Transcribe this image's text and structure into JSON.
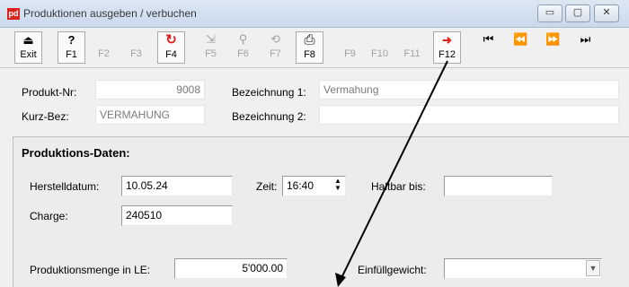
{
  "window": {
    "title": "Produktionen ausgeben / verbuchen",
    "minimize": "▭",
    "maximize": "▢",
    "close": "✕"
  },
  "toolbar": {
    "buttons": [
      {
        "label": "Exit",
        "icon": "cart-icon",
        "glyph": "⏏"
      },
      {
        "label": "F1",
        "icon": "help-icon",
        "glyph": "?"
      },
      {
        "label": "F2",
        "icon": "",
        "glyph": ""
      },
      {
        "label": "F3",
        "icon": "",
        "glyph": ""
      },
      {
        "label": "F4",
        "icon": "refresh-icon",
        "glyph": "↻"
      },
      {
        "label": "F5",
        "icon": "export-icon",
        "glyph": "⇲"
      },
      {
        "label": "F6",
        "icon": "search-icon",
        "glyph": "⚲"
      },
      {
        "label": "F7",
        "icon": "reset-icon",
        "glyph": "⟲"
      },
      {
        "label": "F8",
        "icon": "print-icon",
        "glyph": "⎙"
      },
      {
        "label": "F9",
        "icon": "",
        "glyph": ""
      },
      {
        "label": "F10",
        "icon": "",
        "glyph": ""
      },
      {
        "label": "F11",
        "icon": "",
        "glyph": ""
      },
      {
        "label": "F12",
        "icon": "post-icon",
        "glyph": "➜"
      }
    ],
    "nav": {
      "first": "⏮",
      "prev": "⏪",
      "next": "⏩",
      "last": "⏭"
    }
  },
  "header": {
    "produkt_nr_label": "Produkt-Nr:",
    "produkt_nr": "9008",
    "bezeichnung1_label": "Bezeichnung 1:",
    "bezeichnung1": "Vermahung",
    "kurz_bez_label": "Kurz-Bez:",
    "kurz_bez": "VERMAHUNG",
    "bezeichnung2_label": "Bezeichnung 2:",
    "bezeichnung2": ""
  },
  "production": {
    "title": "Produktions-Daten:",
    "herstelldatum_label": "Herstelldatum:",
    "herstelldatum": "10.05.24",
    "zeit_label": "Zeit:",
    "zeit": "16:40",
    "haltbar_label": "Haltbar bis:",
    "haltbar": "",
    "charge_label": "Charge:",
    "charge": "240510",
    "menge_label": "Produktionsmenge in LE:",
    "menge": "5'000.00",
    "einfuell_label": "Einfüllgewicht:",
    "einfuell": ""
  },
  "colors": {
    "arrow": "#000000",
    "title_bg": "#d4e1f1",
    "logo": "#d8241c"
  }
}
